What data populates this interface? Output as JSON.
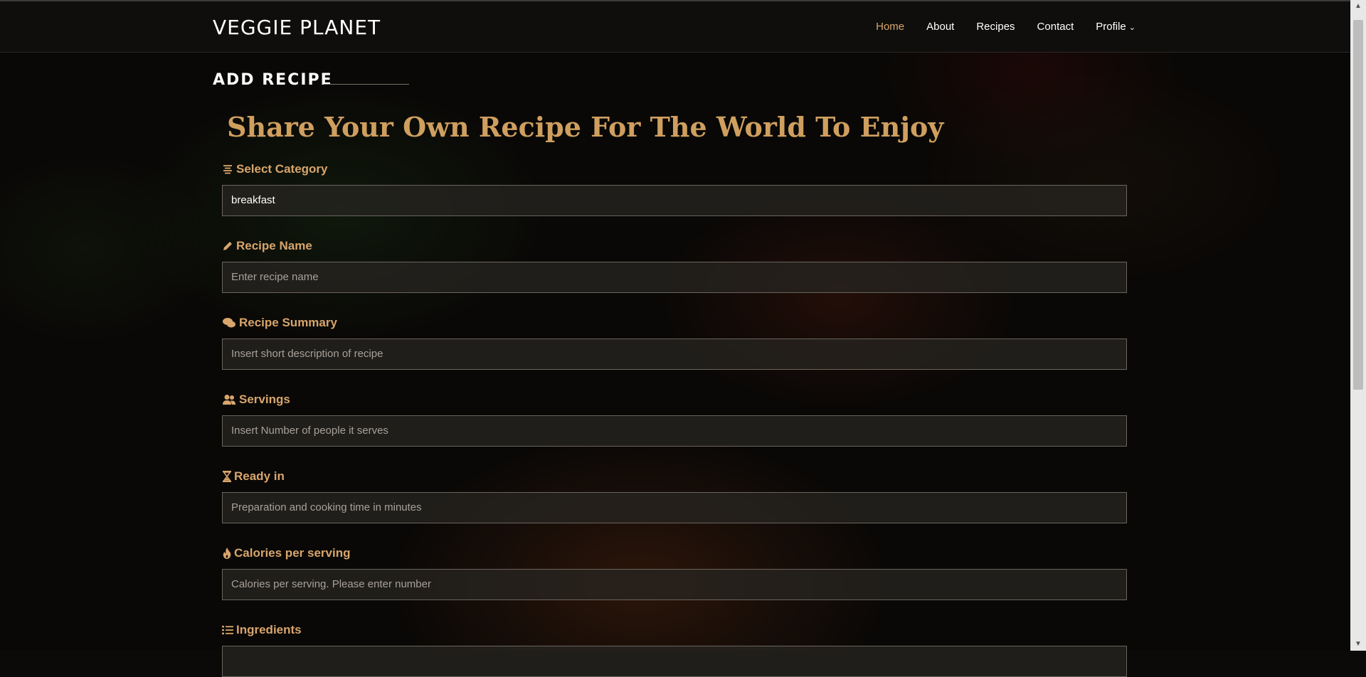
{
  "nav": {
    "brand": "VEGGIE PLANET",
    "links": [
      {
        "label": "Home",
        "active": true
      },
      {
        "label": "About"
      },
      {
        "label": "Recipes"
      },
      {
        "label": "Contact"
      },
      {
        "label": "Profile"
      }
    ]
  },
  "page": {
    "section_title": "ADD RECIPE",
    "headline": "Share Your Own Recipe For The World To Enjoy"
  },
  "form": {
    "category": {
      "label": "Select Category",
      "icon": "align-center-icon",
      "value": "breakfast"
    },
    "name": {
      "label": "Recipe Name",
      "icon": "pencil-icon",
      "placeholder": "Enter recipe name"
    },
    "summary": {
      "label": "Recipe Summary",
      "icon": "comments-icon",
      "placeholder": "Insert short description of recipe"
    },
    "servings": {
      "label": "Servings",
      "icon": "users-icon",
      "placeholder": "Insert Number of people it serves"
    },
    "ready": {
      "label": "Ready in",
      "icon": "hourglass-icon",
      "placeholder": "Preparation and cooking time in minutes"
    },
    "calories": {
      "label": "Calories per serving",
      "icon": "fire-icon",
      "placeholder": "Calories per serving. Please enter number"
    },
    "ingredients": {
      "label": "Ingredients",
      "icon": "list-icon"
    }
  },
  "colors": {
    "accent": "#d8a56c",
    "headline": "#cf9f5f"
  }
}
